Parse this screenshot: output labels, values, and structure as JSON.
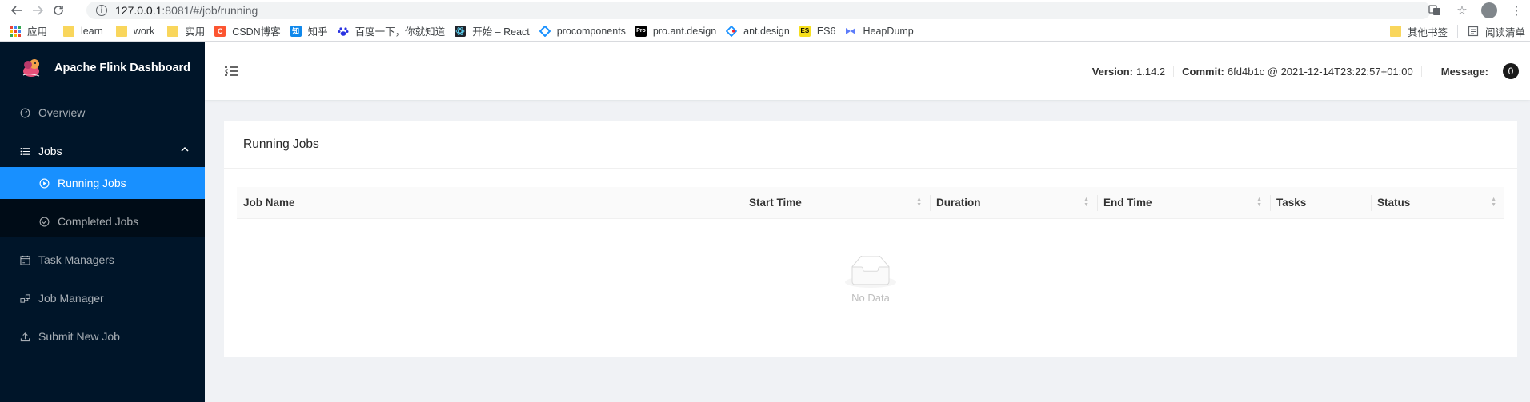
{
  "browser": {
    "url_host": "127.0.0.1",
    "url_rest": ":8081/#/job/running",
    "back_icon": "arrow-left-icon",
    "forward_icon": "arrow-right-icon",
    "reload_icon": "reload-icon"
  },
  "bookmarks": {
    "items": [
      {
        "label": "应用",
        "kind": "apps"
      },
      {
        "label": "learn",
        "kind": "folder"
      },
      {
        "label": "work",
        "kind": "folder"
      },
      {
        "label": "实用",
        "kind": "folder"
      },
      {
        "label": "CSDN博客",
        "kind": "csdn",
        "badge": "C",
        "color": "#fc5531"
      },
      {
        "label": "知乎",
        "kind": "zhihu",
        "badge": "知",
        "color": "#0f88eb"
      },
      {
        "label": "百度一下，你就知道",
        "kind": "baidu",
        "badge": "",
        "color": "#2932e1"
      },
      {
        "label": "开始 – React",
        "kind": "react",
        "badge": "",
        "color": "#20232a"
      },
      {
        "label": "procomponents",
        "kind": "procomponents",
        "badge": "",
        "color": "#1890ff"
      },
      {
        "label": "pro.ant.design",
        "kind": "pro",
        "badge": "Pro",
        "color": "#000000"
      },
      {
        "label": "ant.design",
        "kind": "antd",
        "badge": "",
        "color": "#f5222d"
      },
      {
        "label": "ES6",
        "kind": "es6",
        "badge": "ES",
        "color": "#f7df1e"
      },
      {
        "label": "HeapDump",
        "kind": "heapdump",
        "badge": "",
        "color": "#5c7cfa"
      }
    ],
    "other_label": "其他书签",
    "reading_list_label": "阅读清单"
  },
  "sider": {
    "title": "Apache Flink Dashboard",
    "menu": {
      "overview": "Overview",
      "jobs": "Jobs",
      "running_jobs": "Running Jobs",
      "completed_jobs": "Completed Jobs",
      "task_managers": "Task Managers",
      "job_manager": "Job Manager",
      "submit_new_job": "Submit New Job"
    }
  },
  "header": {
    "version_label": "Version:",
    "version_value": "1.14.2",
    "commit_label": "Commit:",
    "commit_value": "6fd4b1c @ 2021-12-14T23:22:57+01:00",
    "message_label": "Message:",
    "message_count": "0"
  },
  "card": {
    "title": "Running Jobs",
    "columns": [
      "Job Name",
      "Start Time",
      "Duration",
      "End Time",
      "Tasks",
      "Status"
    ],
    "sortable": [
      false,
      true,
      true,
      true,
      false,
      true
    ],
    "empty_text": "No Data"
  },
  "colors": {
    "sider_bg": "#001529",
    "submenu_bg": "#000c17",
    "selected": "#1890ff"
  }
}
